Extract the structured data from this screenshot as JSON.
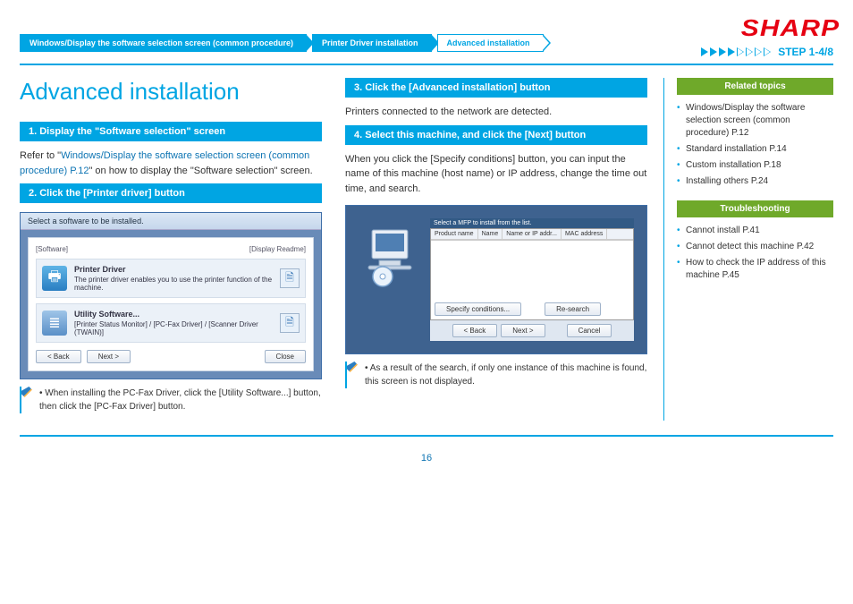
{
  "brand": "SHARP",
  "step_label": "STEP  1-4/8",
  "progress_arrows": {
    "filled": 4,
    "total": 8
  },
  "breadcrumbs": [
    {
      "label": "Windows/Display the software selection screen (common procedure)",
      "active": true
    },
    {
      "label": "Printer Driver installation",
      "active": true
    },
    {
      "label": "Advanced installation",
      "active": false
    }
  ],
  "page_title": "Advanced installation",
  "page_number": "16",
  "left_col": {
    "step1": {
      "bar": "1.   Display the \"Software selection\" screen",
      "text_pre": "Refer to \"",
      "link": "Windows/Display the software selection screen (common procedure) P.12",
      "text_post": "\" on how to display the \"Software selection\" screen."
    },
    "step2": {
      "bar": "2.   Click the [Printer driver] button"
    },
    "screenshot1": {
      "title": "Select a software to be installed.",
      "label_software": "[Software]",
      "label_readme": "[Display Readme]",
      "item1_title": "Printer Driver",
      "item1_desc": "The printer driver enables you to use the printer function of the machine.",
      "item2_title": "Utility Software...",
      "item2_desc": "[Printer Status Monitor] / [PC-Fax Driver] / [Scanner Driver (TWAIN)]",
      "btn_back": "< Back",
      "btn_next": "Next >",
      "btn_close": "Close"
    },
    "note1": "When installing the PC-Fax Driver, click the [Utility Software...] button, then click the [PC-Fax Driver] button."
  },
  "right_col": {
    "step3": {
      "bar": "3.   Click the [Advanced installation] button",
      "desc": "Printers connected to the network are detected."
    },
    "step4": {
      "bar": "4.   Select this machine, and click the [Next] button",
      "desc": "When you click the [Specify conditions] button, you can input the name of this machine (host name) or IP address, change the time out time, and search."
    },
    "screenshot2": {
      "hdr": "Select a MFP to install from the list.",
      "col_product": "Product name",
      "col_name": "Name",
      "col_ip": "Name or IP addr...",
      "col_mac": "MAC address",
      "btn_conditions": "Specify conditions...",
      "btn_research": "Re-search",
      "btn_back": "< Back",
      "btn_next": "Next >",
      "btn_cancel": "Cancel"
    },
    "note2": "As a result of the search, if only one instance of this machine is found, this screen is not displayed."
  },
  "sidebar": {
    "related_head": "Related topics",
    "related_items": [
      "Windows/Display the software selection screen (common procedure) P.12",
      "Standard installation P.14",
      "Custom installation P.18",
      "Installing others P.24"
    ],
    "trouble_head": "Troubleshooting",
    "trouble_items": [
      "Cannot install P.41",
      "Cannot detect this machine P.42",
      "How to check the IP address of this machine P.45"
    ]
  }
}
